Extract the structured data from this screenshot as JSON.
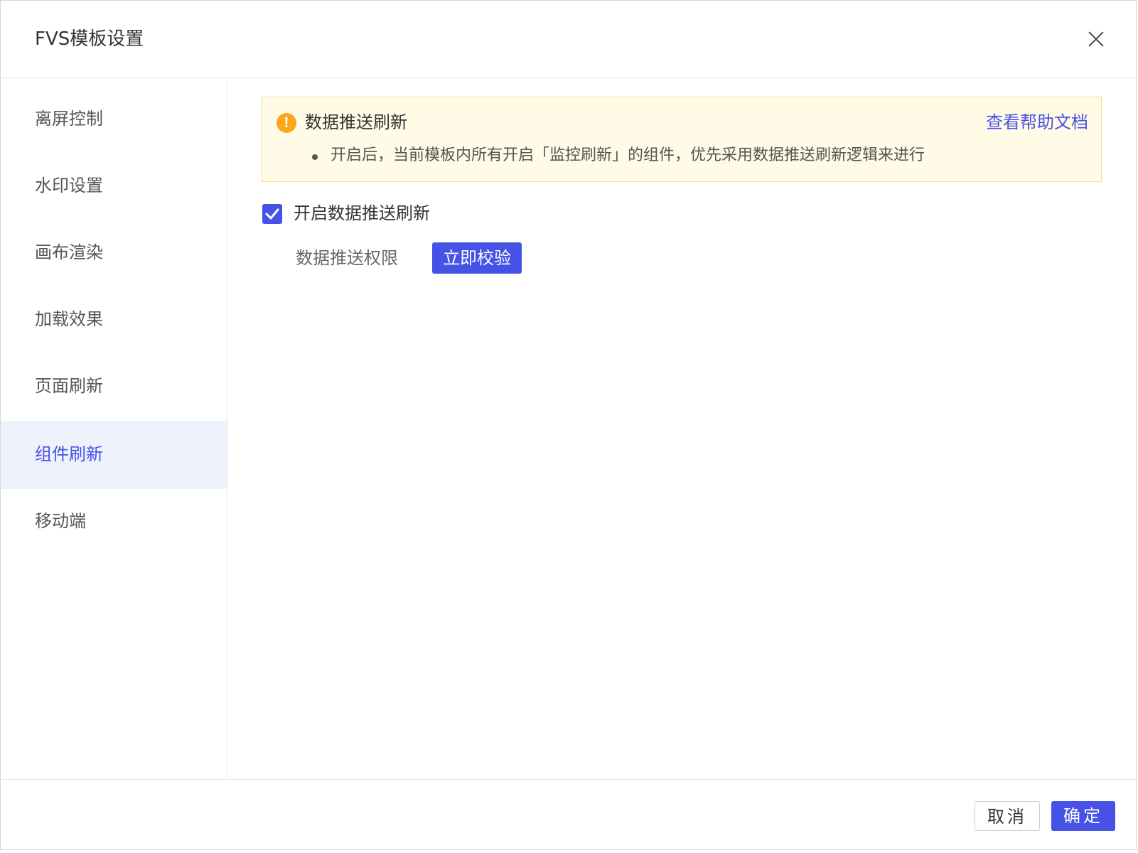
{
  "dialog": {
    "title": "FVS模板设置"
  },
  "sidebar": {
    "items": [
      {
        "label": "离屏控制",
        "active": false
      },
      {
        "label": "水印设置",
        "active": false
      },
      {
        "label": "画布渲染",
        "active": false
      },
      {
        "label": "加载效果",
        "active": false
      },
      {
        "label": "页面刷新",
        "active": false
      },
      {
        "label": "组件刷新",
        "active": true
      },
      {
        "label": "移动端",
        "active": false
      }
    ]
  },
  "alert": {
    "icon": "warning-icon",
    "title": "数据推送刷新",
    "help_link": "查看帮助文档",
    "description": "开启后，当前模板内所有开启「监控刷新」的组件，优先采用数据推送刷新逻辑来进行"
  },
  "push_refresh": {
    "checkbox_label": "开启数据推送刷新",
    "checked": true,
    "permission_label": "数据推送权限",
    "verify_button": "立即校验"
  },
  "footer": {
    "cancel_label": "取消",
    "ok_label": "确定"
  },
  "colors": {
    "accent": "#4652e6",
    "alert_bg": "#fffbe6",
    "alert_border": "#f7dd84",
    "warning": "#faa81a",
    "active_nav_bg": "#eef2fd"
  }
}
